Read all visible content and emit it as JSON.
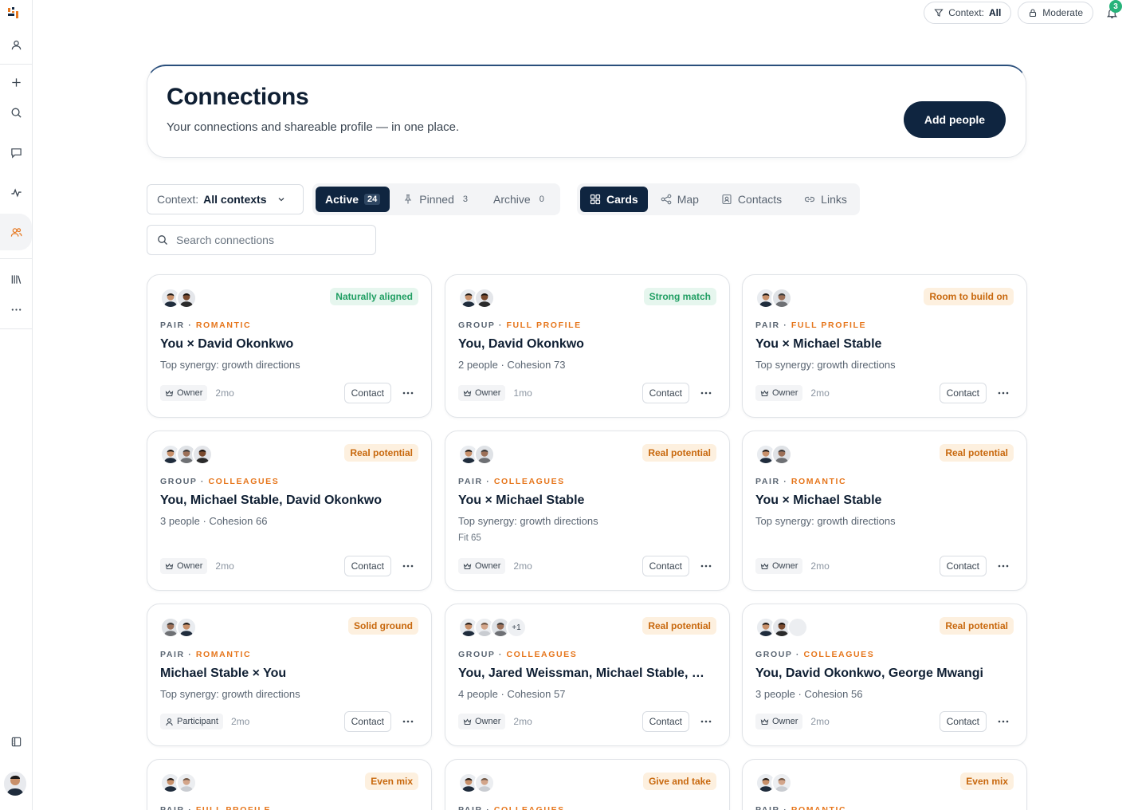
{
  "topbar": {
    "context_label": "Context:",
    "context_value": "All",
    "mode_label": "Moderate",
    "notifications_count": "3"
  },
  "header": {
    "title": "Connections",
    "subtitle": "Your connections and shareable profile — in one place.",
    "add_button": "Add people"
  },
  "filters": {
    "context_label": "Context:",
    "context_value": "All contexts",
    "tabs": [
      {
        "label": "Active",
        "count": "24"
      },
      {
        "label": "Pinned",
        "count": "3"
      },
      {
        "label": "Archive",
        "count": "0"
      }
    ],
    "views": [
      {
        "label": "Cards"
      },
      {
        "label": "Map"
      },
      {
        "label": "Contacts"
      },
      {
        "label": "Links"
      }
    ],
    "search_placeholder": "Search connections"
  },
  "cards": [
    {
      "badge": "Naturally aligned",
      "badge_color": "#1f9e62",
      "kind": "PAIR",
      "sep": " · ",
      "category": "ROMANTIC",
      "name": "You × David Okonkwo",
      "desc": "Top synergy: growth directions",
      "fit": "",
      "role": "Owner",
      "age": "2mo",
      "contact": "Contact"
    },
    {
      "badge": "Strong match",
      "badge_color": "#1f9e62",
      "kind": "GROUP",
      "sep": " · ",
      "category": "FULL PROFILE",
      "name": "You, David Okonkwo",
      "desc": "2 people · Cohesion 73",
      "fit": "",
      "role": "Owner",
      "age": "1mo",
      "contact": "Contact"
    },
    {
      "badge": "Room to build on",
      "badge_color": "#c8680d",
      "kind": "PAIR",
      "sep": " · ",
      "category": "FULL PROFILE",
      "name": "You × Michael Stable",
      "desc": "Top synergy: growth directions",
      "fit": "",
      "role": "Owner",
      "age": "2mo",
      "contact": "Contact"
    },
    {
      "badge": "Real potential",
      "badge_color": "#c8680d",
      "kind": "GROUP",
      "sep": " · ",
      "category": "COLLEAGUES",
      "name": "You, Michael Stable, David Okonkwo",
      "desc": "3 people · Cohesion 66",
      "fit": "",
      "role": "Owner",
      "age": "2mo",
      "contact": "Contact"
    },
    {
      "badge": "Real potential",
      "badge_color": "#c8680d",
      "kind": "PAIR",
      "sep": " · ",
      "category": "COLLEAGUES",
      "name": "You × Michael Stable",
      "desc": "Top synergy: growth directions",
      "fit": "Fit 65",
      "role": "Owner",
      "age": "2mo",
      "contact": "Contact"
    },
    {
      "badge": "Real potential",
      "badge_color": "#c8680d",
      "kind": "PAIR",
      "sep": " · ",
      "category": "ROMANTIC",
      "name": "You × Michael Stable",
      "desc": "Top synergy: growth directions",
      "fit": "",
      "role": "Owner",
      "age": "2mo",
      "contact": "Contact"
    },
    {
      "badge": "Solid ground",
      "badge_color": "#c8680d",
      "kind": "PAIR",
      "sep": " · ",
      "category": "ROMANTIC",
      "name": "Michael Stable × You",
      "desc": "Top synergy: growth directions",
      "fit": "",
      "role": "Participant",
      "age": "2mo",
      "contact": "Contact"
    },
    {
      "badge": "Real potential",
      "badge_color": "#c8680d",
      "kind": "GROUP",
      "sep": " · ",
      "category": "COLLEAGUES",
      "name": "You, Jared Weissman, Michael Stable, …",
      "desc": "4 people · Cohesion 57",
      "fit": "",
      "role": "Owner",
      "age": "2mo",
      "contact": "Contact",
      "more": "+1"
    },
    {
      "badge": "Real potential",
      "badge_color": "#c8680d",
      "kind": "GROUP",
      "sep": " · ",
      "category": "COLLEAGUES",
      "name": "You, David Okonkwo, George Mwangi",
      "desc": "3 people · Cohesion 56",
      "fit": "",
      "role": "Owner",
      "age": "2mo",
      "contact": "Contact"
    },
    {
      "badge": "Even mix",
      "badge_color": "#c8680d",
      "kind": "PAIR",
      "sep": " · ",
      "category": "FULL PROFILE",
      "name": "",
      "desc": "",
      "fit": "",
      "role": "",
      "age": "",
      "contact": ""
    },
    {
      "badge": "Give and take",
      "badge_color": "#c8680d",
      "kind": "PAIR",
      "sep": " · ",
      "category": "COLLEAGUES",
      "name": "",
      "desc": "",
      "fit": "",
      "role": "",
      "age": "",
      "contact": ""
    },
    {
      "badge": "Even mix",
      "badge_color": "#c8680d",
      "kind": "PAIR",
      "sep": " · ",
      "category": "ROMANTIC",
      "name": "",
      "desc": "",
      "fit": "",
      "role": "",
      "age": "",
      "contact": ""
    }
  ]
}
